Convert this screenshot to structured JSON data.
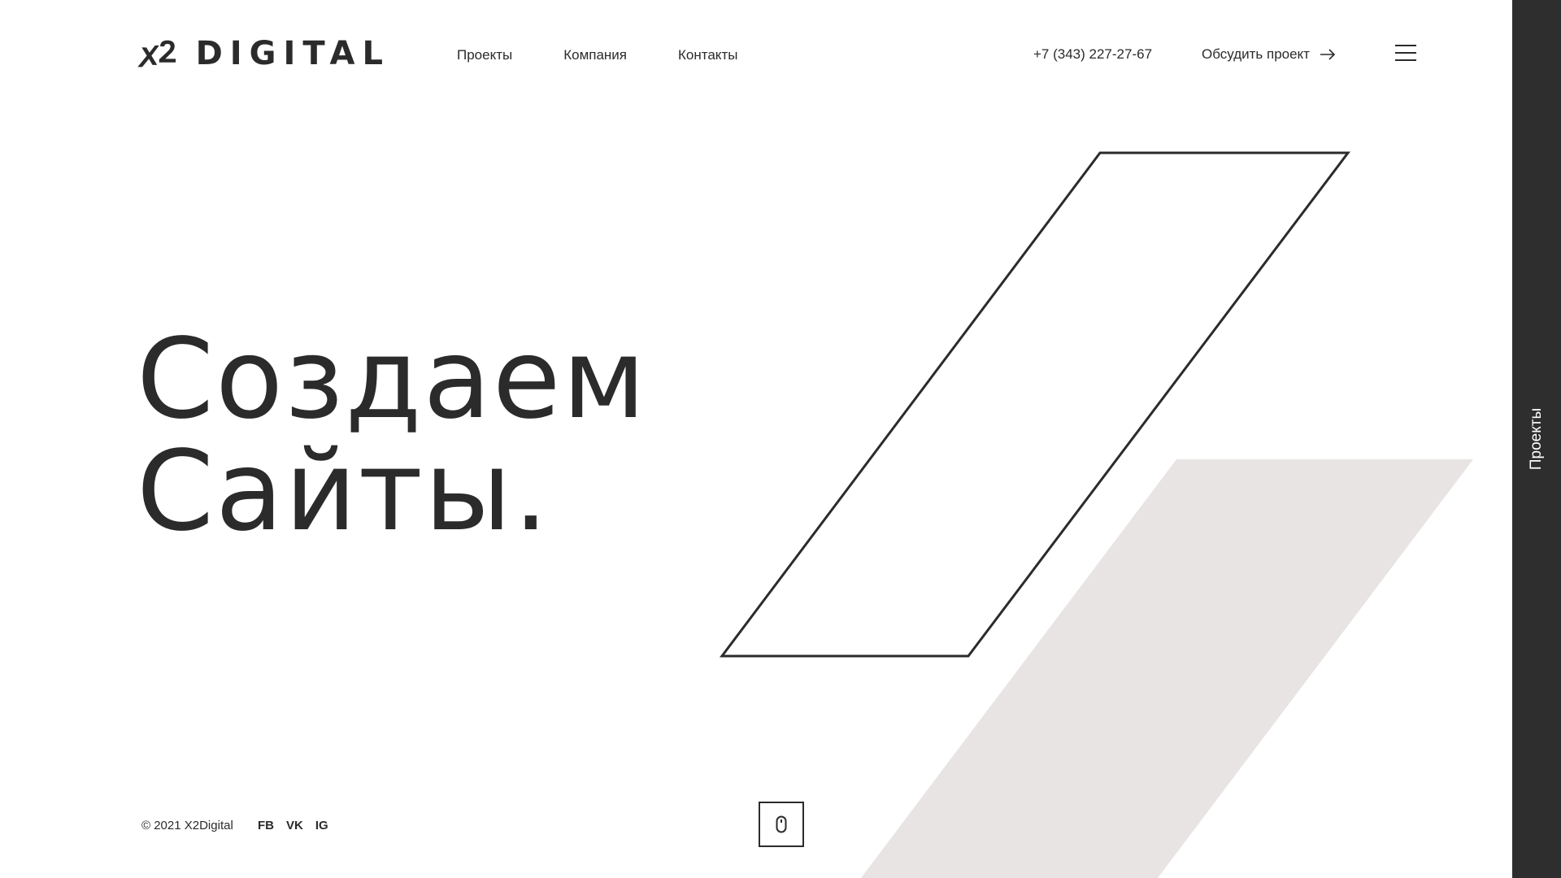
{
  "header": {
    "logo_text": "DIGITAL",
    "logo_mark": "X2",
    "nav": [
      {
        "label": "Проекты"
      },
      {
        "label": "Компания"
      },
      {
        "label": "Контакты"
      }
    ],
    "phone": "+7 (343) 227-27-67",
    "cta_label": "Обсудить проект",
    "cta_icon": "arrow-right-icon",
    "menu_icon": "hamburger-menu-icon"
  },
  "hero": {
    "line1": "Создаем",
    "line2": "Сайты."
  },
  "footer": {
    "copyright": "© 2021 X2Digital",
    "socials": [
      {
        "label": "FB"
      },
      {
        "label": "VK"
      },
      {
        "label": "IG"
      }
    ],
    "scroll_icon": "mouse-scroll-icon"
  },
  "side_panel": {
    "label": "Проекты"
  },
  "colors": {
    "text": "#2b2b2b",
    "panel": "#2e2e2e",
    "shape_fill": "#e8e4e3",
    "background": "#ffffff"
  }
}
